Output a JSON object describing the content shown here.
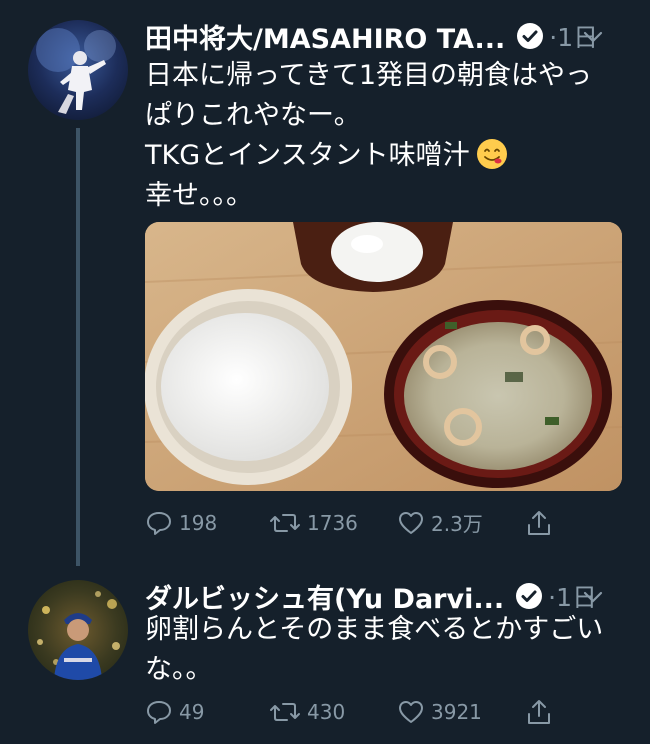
{
  "tweets": [
    {
      "author": "田中将大/MASAHIRO TA...",
      "time": "·1日",
      "lines": [
        "日本に帰ってきて1発目の朝食はやっ",
        "ぱりこれやなー。",
        "TKGとインスタント味噌汁",
        "幸せ。。。"
      ],
      "emoji": "smiling-face-icon",
      "stats": {
        "replies": "198",
        "retweets": "1736",
        "likes": "2.3万"
      }
    },
    {
      "author": "ダルビッシュ有(Yu Darvi...",
      "time": "·1日",
      "lines": [
        "卵割らんとそのまま食べるとかすごい",
        "な。。"
      ],
      "stats": {
        "replies": "49",
        "retweets": "430",
        "likes": "3921"
      }
    }
  ],
  "colors": {
    "background": "#15202b",
    "secondary_text": "#8899a6",
    "thread_line": "#3d5466"
  }
}
